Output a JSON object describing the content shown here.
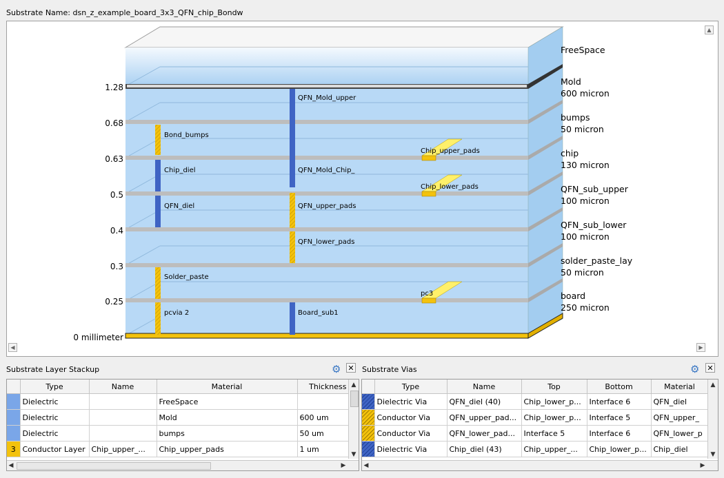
{
  "substrate_label": "Substrate Name:  dsn_z_example_board_3x3_QFN_chip_Bondw",
  "viewer": {
    "axis_labels": [
      "1.28",
      "0.68",
      "0.63",
      "0.5",
      "0.4",
      "0.3",
      "0.25",
      "0 millimeter"
    ],
    "layer_labels": [
      {
        "name": "FreeSpace",
        "thickness": ""
      },
      {
        "name": "Mold",
        "thickness": "600 micron"
      },
      {
        "name": "bumps",
        "thickness": "50 micron"
      },
      {
        "name": "chip",
        "thickness": "130 micron"
      },
      {
        "name": "QFN_sub_upper",
        "thickness": "100 micron"
      },
      {
        "name": "QFN_sub_lower",
        "thickness": "100 micron"
      },
      {
        "name": "solder_paste_lay",
        "thickness": "50 micron"
      },
      {
        "name": "board",
        "thickness": "250 micron"
      }
    ],
    "via_labels": [
      "QFN_Mold_upper",
      "Bond_bumps",
      "Chip_diel",
      "QFN_Mold_Chip_",
      "QFN_diel",
      "QFN_upper_pads",
      "QFN_lower_pads",
      "Solder_paste",
      "pcvia 2",
      "Board_sub1"
    ],
    "pad_labels": [
      "Chip_upper_pads",
      "Chip_lower_pads",
      "pc3"
    ],
    "colors": {
      "dielectric": "#b4d7f5",
      "via_blue": "#3f64c4",
      "via_yellow": "#f3c20d",
      "ground": "#f3c20d"
    }
  },
  "layer_panel": {
    "title": "Substrate Layer Stackup",
    "columns": [
      "Type",
      "Name",
      "Material",
      "Thickness"
    ],
    "rows": [
      {
        "type": "Dielectric",
        "name": "",
        "material": "FreeSpace",
        "thickness": "",
        "swatch": "#7aa6e8",
        "badge": ""
      },
      {
        "type": "Dielectric",
        "name": "",
        "material": "Mold",
        "thickness": "600 um",
        "swatch": "#7aa6e8",
        "badge": ""
      },
      {
        "type": "Dielectric",
        "name": "",
        "material": "bumps",
        "thickness": "50 um",
        "swatch": "#7aa6e8",
        "badge": ""
      },
      {
        "type": "Conductor Layer",
        "name": "Chip_upper_...",
        "material": "Chip_upper_pads",
        "thickness": "1 um",
        "swatch": "#f3c20d",
        "badge": "3"
      }
    ]
  },
  "via_panel": {
    "title": "Substrate Vias",
    "columns": [
      "Type",
      "Name",
      "Top",
      "Bottom",
      "Material"
    ],
    "rows": [
      {
        "type": "Dielectric Via",
        "name": "QFN_diel (40)",
        "top": "Chip_lower_p...",
        "bottom": "Interface 6",
        "material": "QFN_diel",
        "color": "#3f64c4"
      },
      {
        "type": "Conductor Via",
        "name": "QFN_upper_pad...",
        "top": "Chip_lower_p...",
        "bottom": "Interface 5",
        "material": "QFN_upper_",
        "color": "#f3c20d"
      },
      {
        "type": "Conductor Via",
        "name": "QFN_lower_pad...",
        "top": "Interface 5",
        "bottom": "Interface 6",
        "material": "QFN_lower_p",
        "color": "#f3c20d"
      },
      {
        "type": "Dielectric Via",
        "name": "Chip_diel (43)",
        "top": "Chip_upper_...",
        "bottom": "Chip_lower_p...",
        "material": "Chip_diel",
        "color": "#3f64c4"
      }
    ]
  }
}
